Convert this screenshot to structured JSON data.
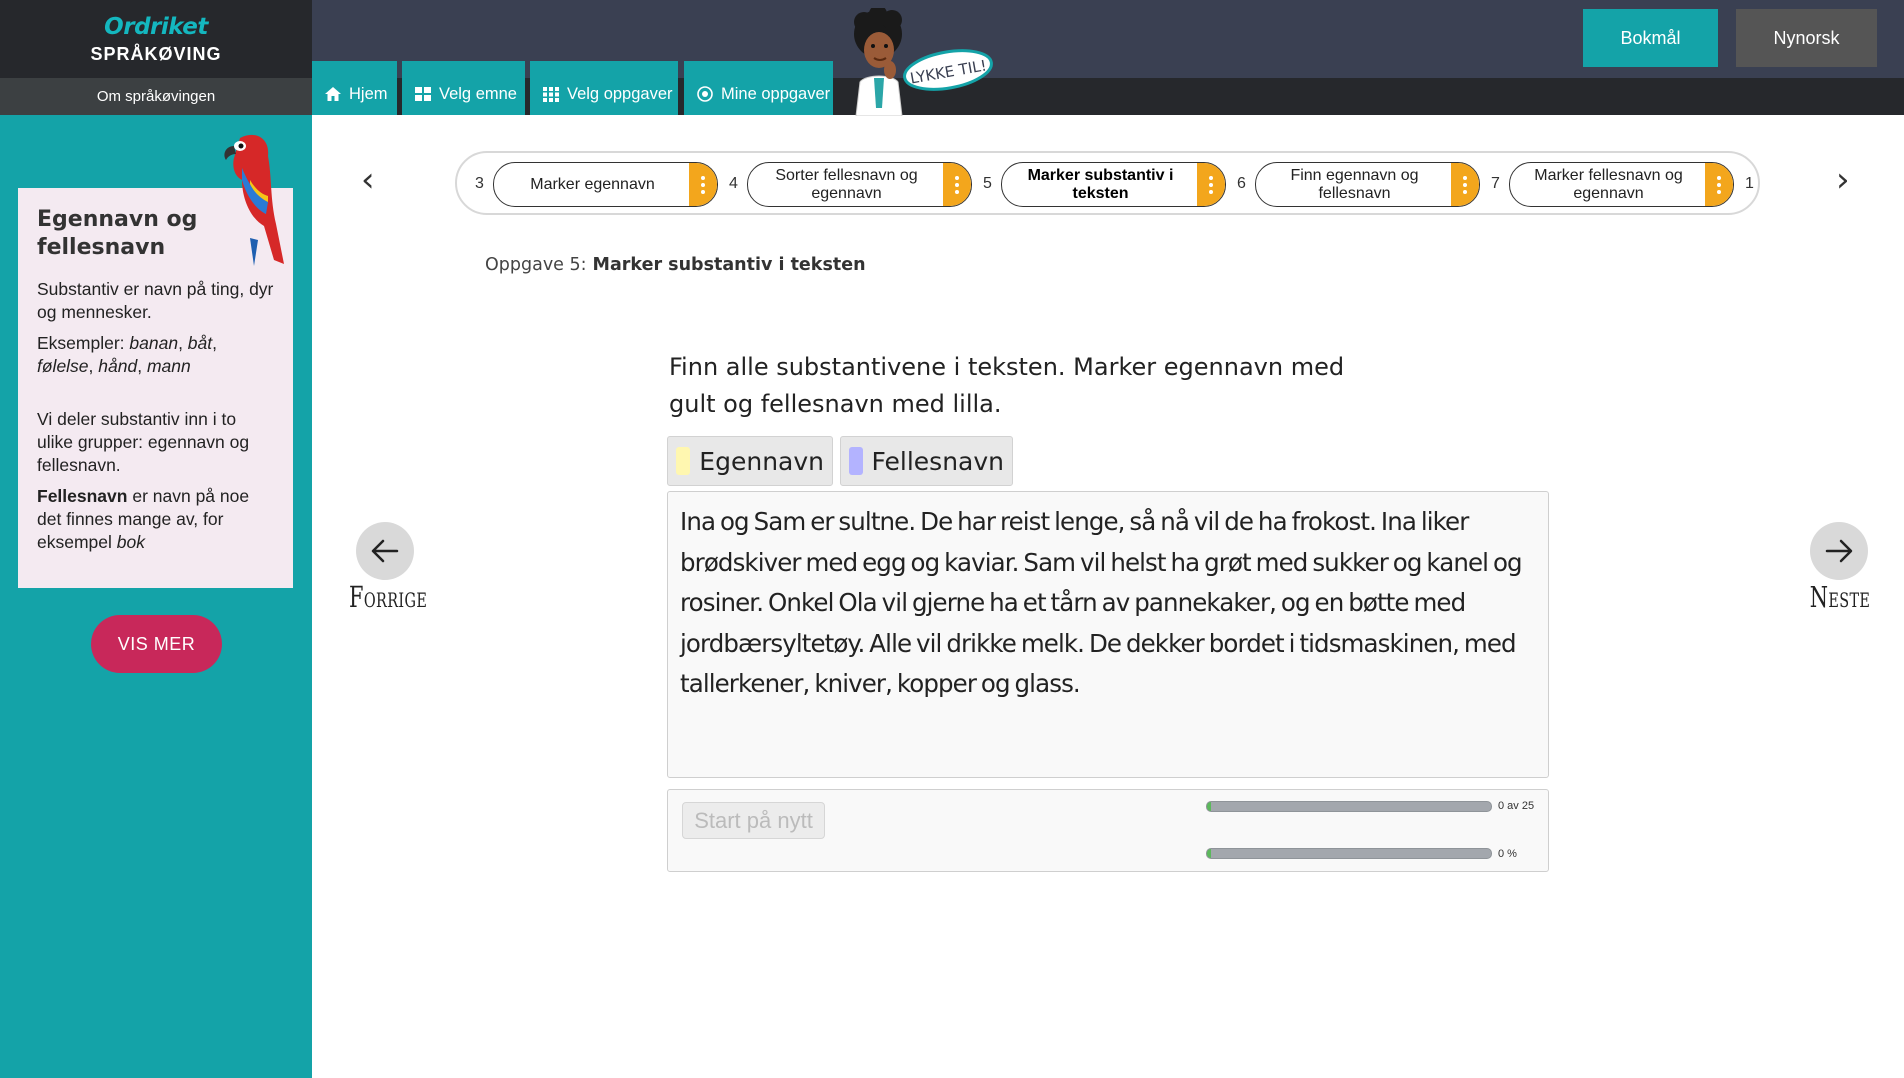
{
  "brand": {
    "logo": "Ordriket",
    "subtitle": "SPRÅKØVING",
    "about_link": "Om språkøvingen"
  },
  "nav": {
    "items": [
      {
        "label": "Hjem",
        "icon": "home-icon"
      },
      {
        "label": "Velg emne",
        "icon": "grid-icon"
      },
      {
        "label": "Velg oppgaver",
        "icon": "list-grid-icon"
      },
      {
        "label": "Mine oppgaver",
        "icon": "target-icon"
      }
    ],
    "lang": [
      {
        "label": "Bokmål",
        "active": true
      },
      {
        "label": "Nynorsk",
        "active": false
      }
    ],
    "avatar_speech": "LYKKE TIL!"
  },
  "info_card": {
    "title": "Egennavn og fellesnavn",
    "p1": "Substantiv er navn på ting, dyr og mennesker.",
    "p2_prefix": "Eksempler: ",
    "examples": [
      "banan",
      "båt",
      "følelse",
      "hånd",
      "mann"
    ],
    "p3": "Vi deler substantiv inn i to ulike grupper: egennavn og fellesnavn.",
    "p4_bold": "Fellesnavn",
    "p4_rest": " er navn på noe det finnes mange av, for eksempel ",
    "p4_example": "bok",
    "vis_mer": "VIS MER"
  },
  "stepper": {
    "prev_symbol": "‹",
    "next_symbol": "›",
    "steps": [
      {
        "num": "3",
        "label": "Marker egennavn",
        "active": false
      },
      {
        "num": "4",
        "label": "Sorter fellesnavn og egennavn",
        "active": false
      },
      {
        "num": "5",
        "label": "Marker substantiv i teksten",
        "active": true
      },
      {
        "num": "6",
        "label": "Finn egennavn og fellesnavn",
        "active": false
      },
      {
        "num": "7",
        "label": "Marker fellesnavn og egennavn",
        "active": false
      },
      {
        "num": "1",
        "label": "",
        "active": false
      }
    ]
  },
  "task": {
    "prefix": "Oppgave 5:",
    "title": "Marker substantiv i teksten",
    "instruction": "Finn alle substantivene i teksten. Marker egennavn med gult og fellesnavn med lilla.",
    "markers": [
      {
        "label": "Egennavn",
        "color": "#fff7b0"
      },
      {
        "label": "Fellesnavn",
        "color": "#b3b3ff"
      }
    ],
    "text": "Ina og Sam er sultne. De har reist lenge, så nå vil de ha frokost. Ina liker brødskiver med egg og kaviar. Sam vil helst ha grøt med sukker og kanel og rosiner. Onkel Ola vil gjerne ha et tårn av pannekaker, og en bøtte med jordbærsyltetøy. Alle vil drikke melk. De dekker bordet i tidsmaskinen, med tallerkener, kniver, kopper og glass.",
    "restart": "Start på nytt",
    "score_text": "0 av 25",
    "score_value": 0,
    "score_max": 25,
    "percent_text": "0 %",
    "percent_value": 0
  },
  "navigation": {
    "prev": "Forrige",
    "next": "Neste"
  },
  "colors": {
    "teal": "#14a3a8",
    "dark": "#26282c",
    "topbar": "#3a4052",
    "orange": "#f3a61c",
    "pink": "#c8285a",
    "card": "#f4eaf1"
  }
}
